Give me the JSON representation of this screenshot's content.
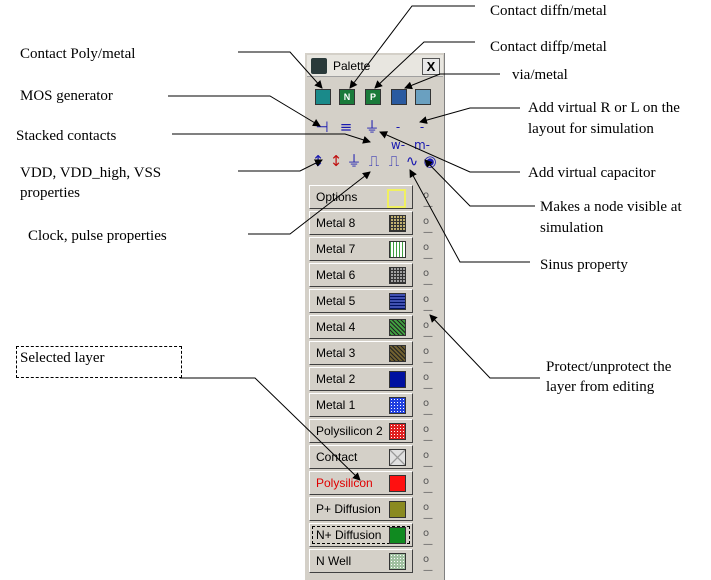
{
  "palette": {
    "title": "Palette",
    "close_label": "X",
    "contact_icons": [
      {
        "label": "",
        "color": "#1a8a8a"
      },
      {
        "label": "N",
        "color": "#1a7a3a"
      },
      {
        "label": "P",
        "color": "#1a7a3a"
      },
      {
        "label": "",
        "color": "#2a5aa0"
      },
      {
        "label": "",
        "color": "#6aa0c0"
      }
    ],
    "tool_icons": [
      "mos-generator",
      "stacked-contacts",
      "virtual-capacitor-ground",
      "virtual-resistor",
      "virtual-inductor"
    ],
    "property_icons": [
      "vdd-arrow",
      "vdd-high-arrow",
      "vss",
      "clock",
      "pulse",
      "sinus",
      "visible-node-eye"
    ],
    "layers": [
      {
        "name": "Options",
        "color": "#f0f060",
        "pattern": "outline",
        "selected": false,
        "name_color": "#000000"
      },
      {
        "name": "Metal 8",
        "color": "#c0b070",
        "pattern": "grid",
        "selected": false,
        "name_color": "#000000"
      },
      {
        "name": "Metal 7",
        "color": "#a0d0a0",
        "pattern": "wave",
        "selected": false,
        "name_color": "#000000"
      },
      {
        "name": "Metal 6",
        "color": "#a0a0a0",
        "pattern": "grid",
        "selected": false,
        "name_color": "#000000"
      },
      {
        "name": "Metal 5",
        "color": "#4050b0",
        "pattern": "lines",
        "selected": false,
        "name_color": "#000000"
      },
      {
        "name": "Metal 4",
        "color": "#40a040",
        "pattern": "hatch",
        "selected": false,
        "name_color": "#000000"
      },
      {
        "name": "Metal 3",
        "color": "#706030",
        "pattern": "hatch",
        "selected": false,
        "name_color": "#000000"
      },
      {
        "name": "Metal 2",
        "color": "#0010a0",
        "pattern": "solid",
        "selected": false,
        "name_color": "#000000"
      },
      {
        "name": "Metal 1",
        "color": "#2040e0",
        "pattern": "dots",
        "selected": false,
        "name_color": "#000000"
      },
      {
        "name": "Polysilicon 2",
        "color": "#e02020",
        "pattern": "dots",
        "selected": false,
        "name_color": "#000000"
      },
      {
        "name": "Contact",
        "color": "#e0e0e0",
        "pattern": "cross",
        "selected": false,
        "name_color": "#000000"
      },
      {
        "name": "Polysilicon",
        "color": "#ff1010",
        "pattern": "solid",
        "selected": false,
        "name_color": "#e00000"
      },
      {
        "name": "P+ Diffusion",
        "color": "#8a8a20",
        "pattern": "solid",
        "selected": false,
        "name_color": "#000000"
      },
      {
        "name": "N+ Diffusion",
        "color": "#108a20",
        "pattern": "solid",
        "selected": true,
        "name_color": "#000000"
      },
      {
        "name": "N Well",
        "color": "#a0c0a0",
        "pattern": "dots",
        "selected": false,
        "name_color": "#000000"
      }
    ]
  },
  "annotations": {
    "contact_diffn": "Contact diffn/metal",
    "contact_poly": "Contact Poly/metal",
    "contact_diffp": "Contact diffp/metal",
    "via_metal": "via/metal",
    "mos_generator": "MOS generator",
    "add_virtual_rl_1": "Add virtual R or L on the",
    "add_virtual_rl_2": "layout for simulation",
    "stacked_contacts": "Stacked contacts",
    "vdd_props_1": "VDD, VDD_high, VSS",
    "vdd_props_2": "properties",
    "add_virtual_cap": "Add virtual capacitor",
    "visible_node_1": "Makes a node visible at",
    "visible_node_2": "simulation",
    "clock_pulse": "Clock, pulse properties",
    "sinus": "Sinus property",
    "selected_layer": "Selected layer",
    "protect_1": "Protect/unprotect the",
    "protect_2": "layer from editing"
  }
}
